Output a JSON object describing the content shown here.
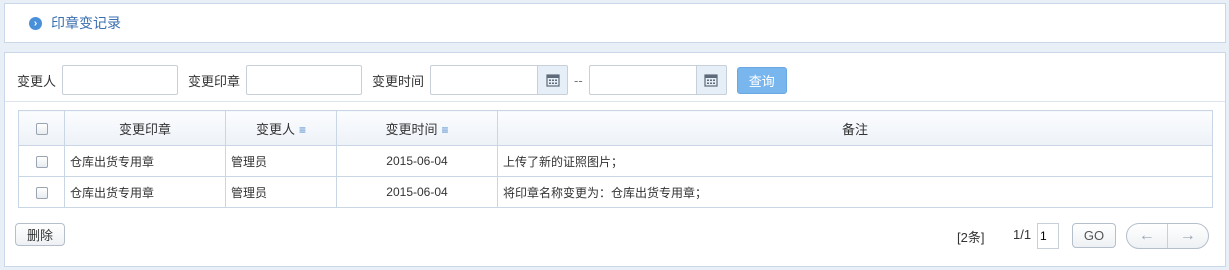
{
  "page": {
    "title": "印章变记录"
  },
  "search": {
    "changer_label": "变更人",
    "seal_label": "变更印章",
    "time_label": "变更时间",
    "range_sep": "--",
    "query_label": "查询",
    "changer_value": "",
    "seal_value": "",
    "time_from_value": "",
    "time_to_value": ""
  },
  "table": {
    "headers": {
      "seal": "变更印章",
      "changer": "变更人",
      "time": "变更时间",
      "remark": "备注"
    },
    "rows": [
      {
        "seal": "仓库出货专用章",
        "changer": "管理员",
        "time": "2015-06-04",
        "remark": "上传了新的证照图片；"
      },
      {
        "seal": "仓库出货专用章",
        "changer": "管理员",
        "time": "2015-06-04",
        "remark": "将印章名称变更为：仓库出货专用章；"
      }
    ]
  },
  "footer": {
    "delete_label": "删除",
    "count_text": "[2条]",
    "page_info": "1/1",
    "page_input_value": "1",
    "go_label": "GO"
  },
  "icons": {
    "title": "chevron-right-circle-icon",
    "calendar": "calendar-icon",
    "sort": "sort-menu-icon",
    "prev": "arrow-left-icon",
    "next": "arrow-right-icon"
  },
  "colors": {
    "accent": "#4a90d9",
    "query_button": "#7ab6ee",
    "title_text": "#3a6fb0"
  }
}
